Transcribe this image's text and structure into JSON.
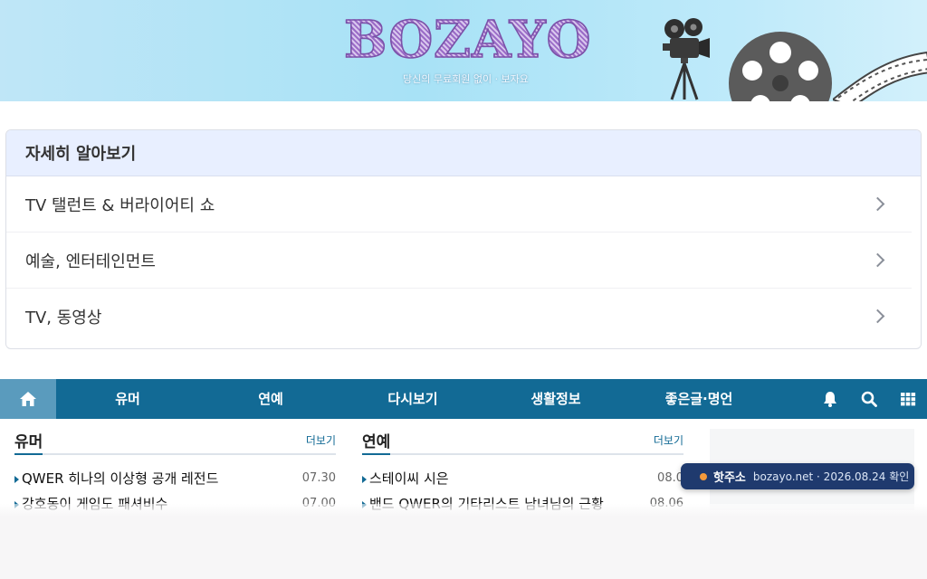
{
  "header": {
    "logo_text": "BOZAYO",
    "tagline": "당신의 무료회원 없이 · 보자요"
  },
  "card": {
    "title": "자세히 알아보기",
    "items": [
      {
        "label": "TV 탤런트 & 버라이어티 쇼"
      },
      {
        "label": "예술, 엔터테인먼트"
      },
      {
        "label": "TV, 동영상"
      }
    ]
  },
  "nav": {
    "home_icon": "home-icon",
    "items": [
      {
        "label": "유머"
      },
      {
        "label": "연예"
      },
      {
        "label": "다시보기"
      },
      {
        "label": "생활정보"
      },
      {
        "label": "좋은글·명언"
      }
    ],
    "icons": [
      "bell-icon",
      "search-icon",
      "grid-icon"
    ],
    "bar_color": "#126a95",
    "home_color": "#5a9bbd"
  },
  "sections": [
    {
      "title": "유머",
      "more": "더보기",
      "posts": [
        {
          "title": "QWER 히나의 이상형 공개 레전드",
          "date": "07.30"
        },
        {
          "title": "강호동이 게임도 패셔비수",
          "date": "07.00"
        }
      ]
    },
    {
      "title": "연예",
      "more": "더보기",
      "posts": [
        {
          "title": "스테이씨 시은",
          "date": "08.0"
        },
        {
          "title": "밴드 QWER의 기타리스트 남녀님의 근황",
          "date": "08.06"
        }
      ]
    }
  ],
  "toast": {
    "label": "핫주소",
    "message": "bozayo.net · 2026.08.24 확인",
    "dot_color": "#f59a3b"
  }
}
